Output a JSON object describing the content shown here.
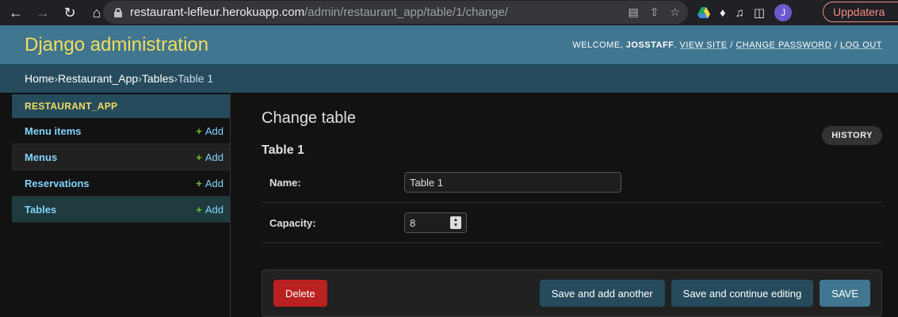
{
  "browser": {
    "url_host": "restaurant-lefleur.herokuapp.com",
    "url_path": "/admin/restaurant_app/table/1/change/",
    "profile_initial": "J",
    "update_label": "Uppdatera",
    "update_color": "#f28b82"
  },
  "header": {
    "branding": "Django administration",
    "welcome": "WELCOME, ",
    "username": "JOSSTAFF",
    "separator_after_user": ". ",
    "view_site": "VIEW SITE",
    "slash1": " / ",
    "change_password": "CHANGE PASSWORD",
    "slash2": " / ",
    "log_out": "LOG OUT",
    "brand_color": "#f5dd5d",
    "header_bg": "#417690"
  },
  "breadcrumbs": {
    "home": "Home",
    "app": "Restaurant_App",
    "model": "Tables",
    "current": "Table 1",
    "sep": " › "
  },
  "sidebar": {
    "caption": "RESTAURANT_APP",
    "add_label": "Add",
    "items": [
      {
        "label": "Menu items"
      },
      {
        "label": "Menus"
      },
      {
        "label": "Reservations"
      },
      {
        "label": "Tables"
      }
    ]
  },
  "main": {
    "page_title": "Change table",
    "history_label": "HISTORY",
    "object_title": "Table 1",
    "fields": {
      "name_label": "Name:",
      "name_value": "Table 1",
      "capacity_label": "Capacity:",
      "capacity_value": "8"
    },
    "buttons": {
      "delete": "Delete",
      "save_add_another": "Save and add another",
      "save_continue": "Save and continue editing",
      "save": "SAVE"
    },
    "delete_color": "#ba2121"
  }
}
